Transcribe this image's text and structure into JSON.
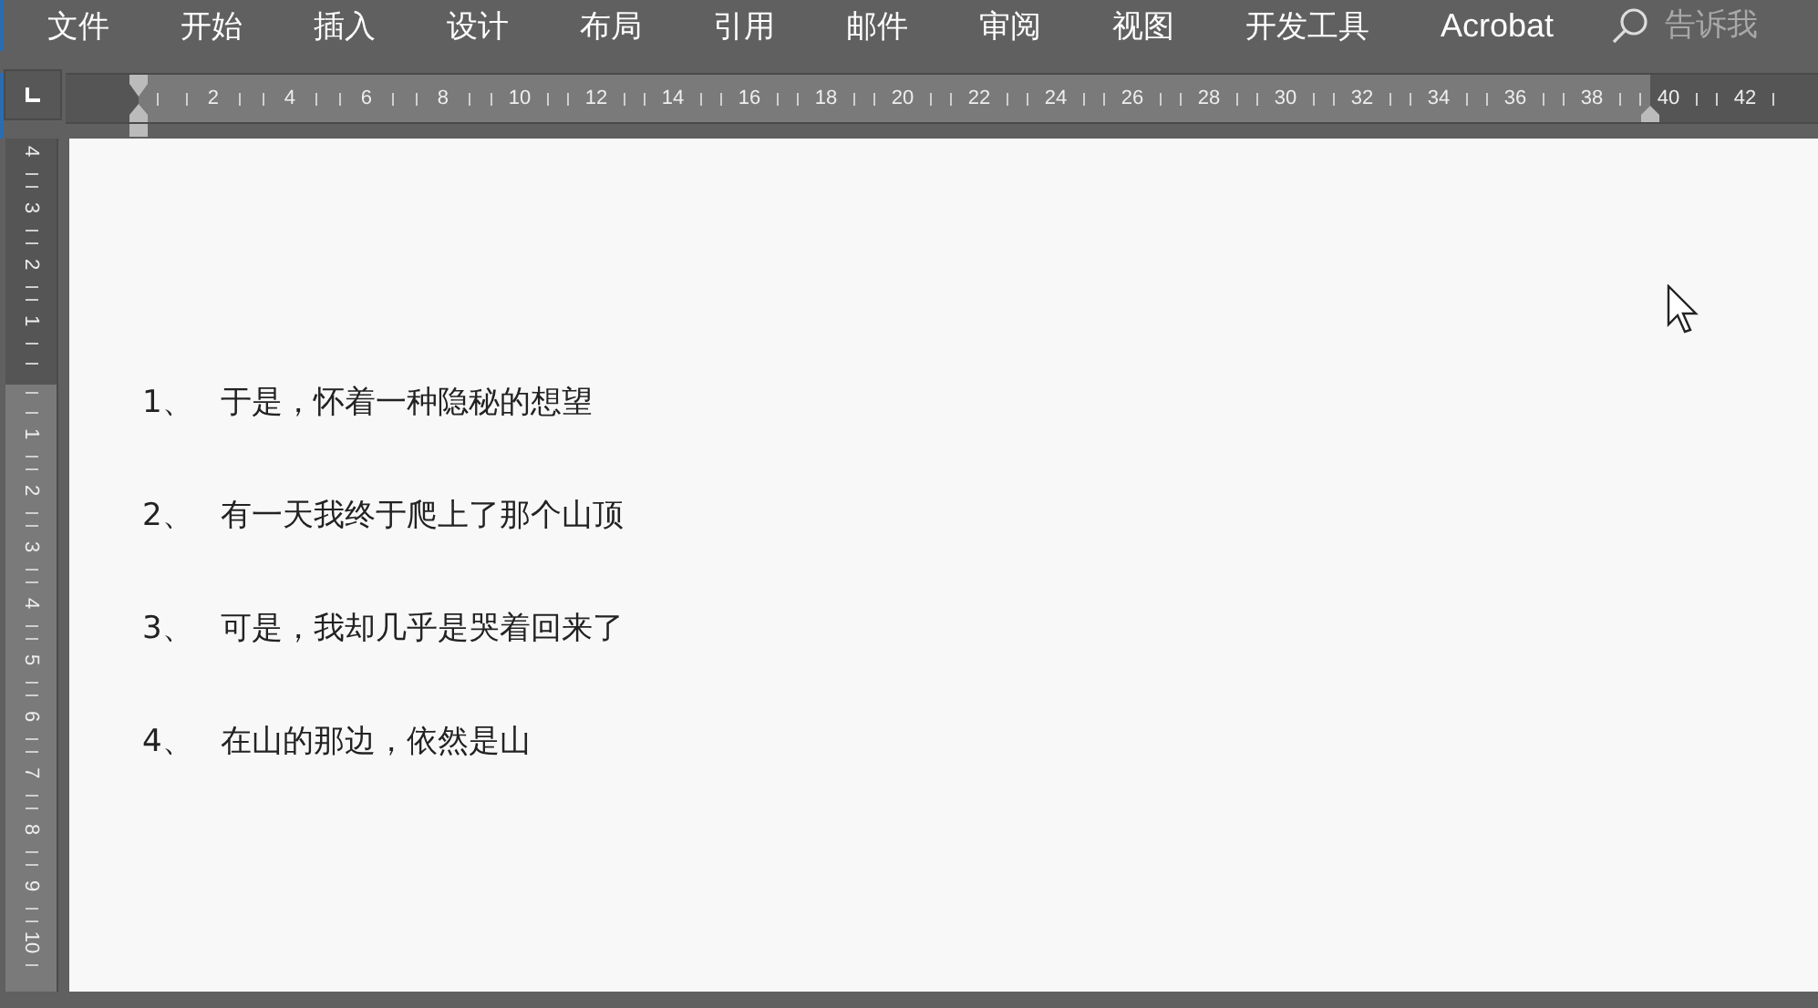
{
  "menu": {
    "items": [
      "文件",
      "开始",
      "插入",
      "设计",
      "布局",
      "引用",
      "邮件",
      "审阅",
      "视图",
      "开发工具",
      "Acrobat"
    ]
  },
  "search": {
    "placeholder": "告诉我"
  },
  "horizontal_ruler": {
    "labels": [
      "2",
      "4",
      "6",
      "8",
      "10",
      "12",
      "14",
      "16",
      "18",
      "20",
      "22",
      "24",
      "26",
      "28",
      "30",
      "32",
      "34",
      "36",
      "38",
      "40",
      "42"
    ]
  },
  "vertical_ruler": {
    "top_labels": [
      "4",
      "3",
      "2",
      "1"
    ],
    "labels": [
      "1",
      "2",
      "3",
      "4",
      "5",
      "6",
      "7",
      "8",
      "9",
      "10"
    ]
  },
  "document": {
    "items": [
      {
        "number": "1、",
        "text": "于是，怀着一种隐秘的想望"
      },
      {
        "number": "2、",
        "text": "有一天我终于爬上了那个山顶"
      },
      {
        "number": "3、",
        "text": "可是，我却几乎是哭着回来了"
      },
      {
        "number": "4、",
        "text": "在山的那边，依然是山"
      }
    ]
  }
}
